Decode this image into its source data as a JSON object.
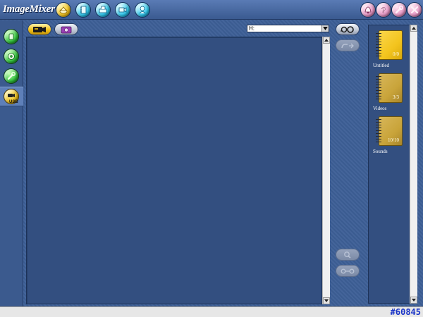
{
  "app": {
    "title": "ImageMixer"
  },
  "toolbar": {
    "nav_buttons": [
      {
        "name": "home-button",
        "icon": "home-icon",
        "color": "yellow"
      },
      {
        "name": "album-button",
        "icon": "album-icon",
        "color": "cyan"
      },
      {
        "name": "print-button",
        "icon": "print-icon",
        "color": "cyan"
      },
      {
        "name": "video-edit-button",
        "icon": "video-edit-icon",
        "color": "cyan"
      },
      {
        "name": "share-button",
        "icon": "share-icon",
        "color": "cyan"
      }
    ],
    "right_buttons": [
      {
        "name": "notify-button",
        "icon": "bell-icon"
      },
      {
        "name": "help-button",
        "icon": "question-icon"
      },
      {
        "name": "settings-button",
        "icon": "wrench-icon"
      },
      {
        "name": "close-button",
        "icon": "close-icon"
      }
    ]
  },
  "sidebar": {
    "items": [
      {
        "name": "import-button",
        "icon": "import-icon"
      },
      {
        "name": "disc-button",
        "icon": "disc-icon"
      },
      {
        "name": "tools-button",
        "icon": "tools-icon"
      },
      {
        "name": "usb-button",
        "icon": "usb-camera-icon",
        "label": "USB",
        "selected": true
      }
    ]
  },
  "modes": {
    "video": {
      "icon": "video-camera-icon",
      "selected": true
    },
    "photo": {
      "icon": "photo-camera-icon",
      "selected": false
    }
  },
  "drive": {
    "selected": "H:"
  },
  "albums": [
    {
      "label": "Untitled",
      "count": "0/0",
      "color": "#f3c41e"
    },
    {
      "label": "Videos",
      "count": "3/3",
      "color": "#c9a43a"
    },
    {
      "label": "Sounds",
      "count": "10/10",
      "color": "#c9a43a"
    }
  ],
  "status": {
    "code": "#60845"
  },
  "colors": {
    "background": "#3d5f96",
    "pane": "#334f80",
    "status_text": "#1a34c8"
  }
}
